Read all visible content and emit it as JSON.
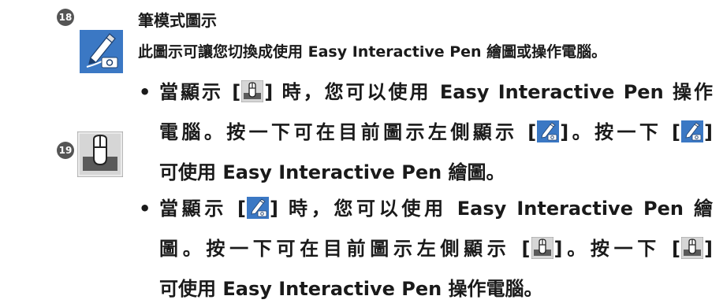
{
  "markers": {
    "n18": "18",
    "n19": "19"
  },
  "icons": {
    "pen_mode_icon": "pen-mode-icon",
    "mouse_mode_icon": "mouse-mode-icon",
    "pen_color": "#3b78c4",
    "mouse_bg": "#d6d6d6"
  },
  "section": {
    "title": "筆模式圖示",
    "description": "此圖示可讓您切換成使用 Easy Interactive Pen 繪圖或操作電腦。"
  },
  "bullet1": {
    "dot": "•",
    "l1_pre": "當顯示 [",
    "l1_post": "] 時，您可以使用 Easy Interactive Pen 操作",
    "l2_pre": "電腦。按一下可在目前圖示左側顯示 [",
    "l2_mid": "]。按一下 [",
    "l2_post": "]",
    "l3": "可使用 Easy Interactive Pen 繪圖。"
  },
  "bullet2": {
    "dot": "•",
    "l1_pre": "當顯示 [",
    "l1_post": "] 時，您可以使用 Easy Interactive Pen 繪",
    "l2_pre": "圖。按一下可在目前圖示左側顯示 [",
    "l2_mid": "]。按一下 [",
    "l2_post": "]",
    "l3": "可使用 Easy Interactive Pen 操作電腦。"
  }
}
